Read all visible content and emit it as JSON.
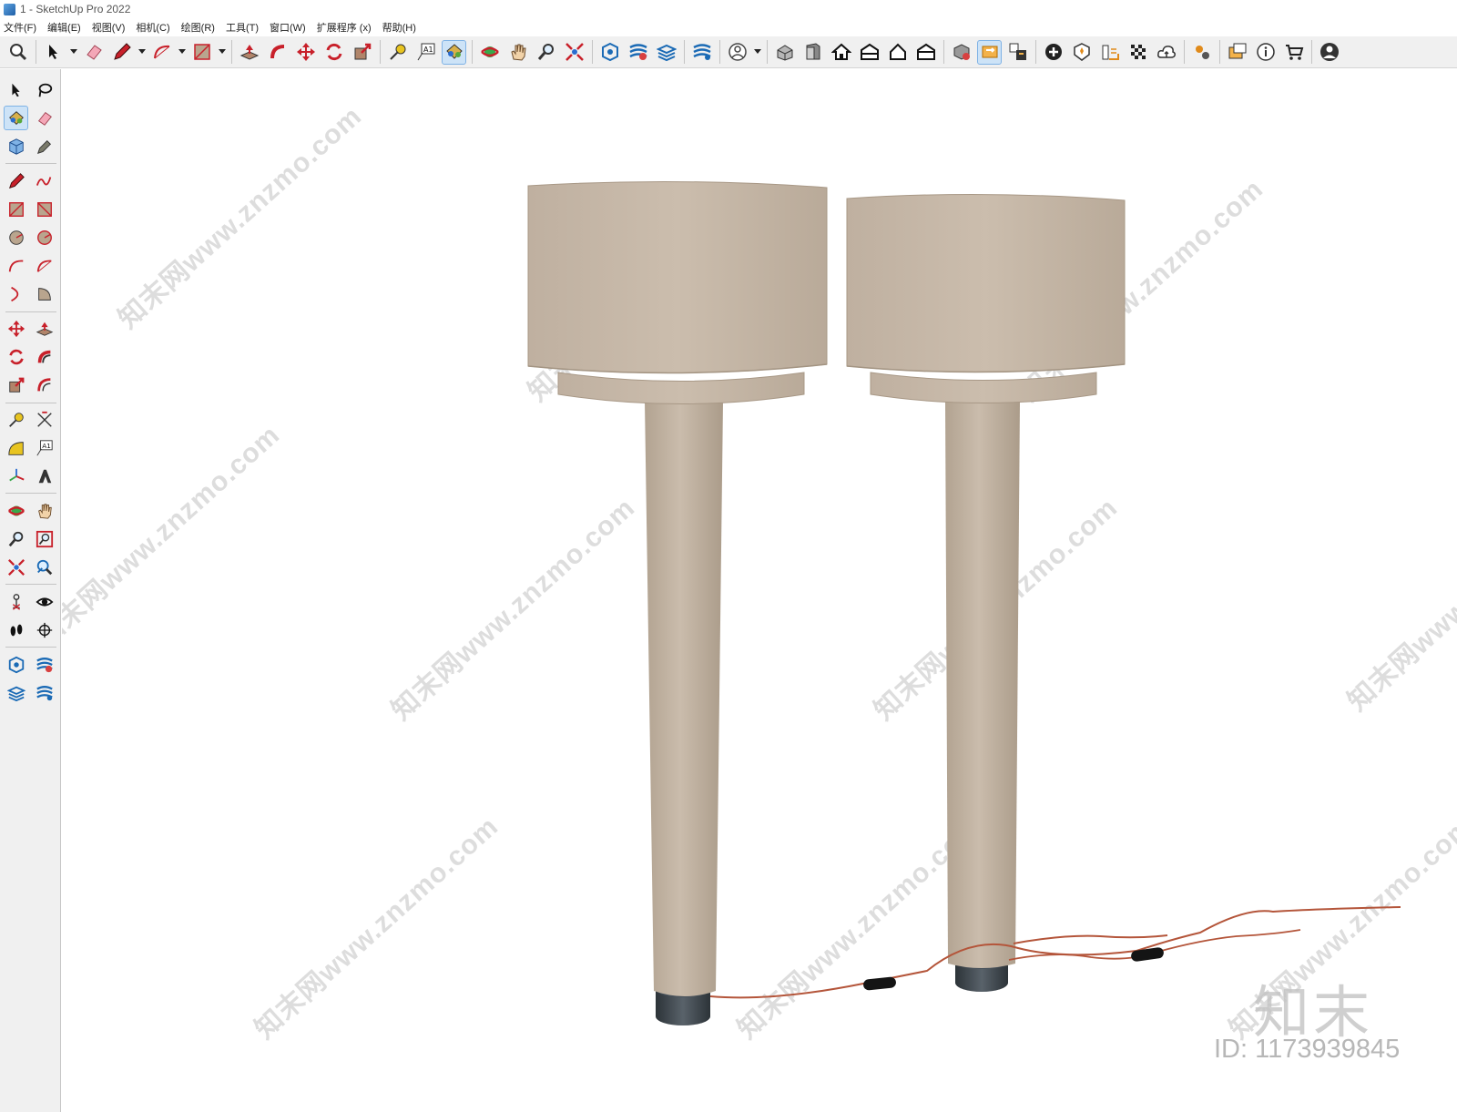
{
  "window": {
    "title": "1 - SketchUp Pro 2022",
    "app_icon": "sketchup-logo-icon"
  },
  "menu": {
    "items": [
      {
        "label": "文件(F)"
      },
      {
        "label": "编辑(E)"
      },
      {
        "label": "视图(V)"
      },
      {
        "label": "相机(C)"
      },
      {
        "label": "绘图(R)"
      },
      {
        "label": "工具(T)"
      },
      {
        "label": "窗口(W)"
      },
      {
        "label": "扩展程序 (x)"
      },
      {
        "label": "帮助(H)"
      }
    ]
  },
  "toolbar": {
    "icons": [
      "zoom-extents-icon",
      "select-icon",
      "eraser-icon",
      "pencil-icon",
      "arc-icon",
      "rectangle-icon",
      "push-pull-icon",
      "follow-me-icon",
      "move-icon",
      "rotate-icon",
      "scale-icon",
      "tape-measure-icon",
      "text-icon",
      "paint-bucket-icon",
      "orbit-icon",
      "pan-icon",
      "zoom-icon",
      "zoom-window-icon",
      "sandbox-icon",
      "layers-icon",
      "tags-icon",
      "outliner-icon",
      "styles-icon",
      "iso-view-icon",
      "front-view-icon",
      "home-view-icon",
      "right-view-icon",
      "back-view-icon",
      "left-view-icon",
      "solid-tools-icon",
      "section-plane-icon",
      "section-display-icon",
      "add-location-icon",
      "shadows-icon",
      "fog-icon",
      "match-photo-icon",
      "cloud-icon",
      "extension-manager-icon",
      "dialog-icon",
      "info-icon",
      "warehouse-icon",
      "account-icon"
    ]
  },
  "sidebar": {
    "icons": [
      "select-icon",
      "lasso-icon",
      "paint-bucket-icon",
      "eraser-icon",
      "component-icon",
      "tag-icon",
      "line-icon",
      "freehand-icon",
      "rectangle-icon",
      "rotated-rectangle-icon",
      "circle-icon",
      "polygon-icon",
      "arc-icon",
      "two-point-arc-icon",
      "three-point-arc-icon",
      "pie-icon",
      "move-icon",
      "push-pull-icon",
      "rotate-icon",
      "follow-me-icon",
      "scale-icon",
      "offset-icon",
      "tape-measure-icon",
      "dimension-icon",
      "protractor-icon",
      "text-icon",
      "axes-icon",
      "3d-text-icon",
      "orbit-icon",
      "pan-icon",
      "zoom-icon",
      "zoom-window-icon",
      "zoom-extents-icon",
      "previous-view-icon",
      "position-camera-icon",
      "look-around-icon",
      "walk-icon",
      "section-plane-icon",
      "sandbox-icon",
      "layers-icon",
      "tags-icon",
      "outliner-icon"
    ]
  },
  "viewport": {
    "scene": "two-floor-lamps-with-linen-shades",
    "watermark": "知末网www.znzmo.com",
    "brand_mark": "知末",
    "id_label": "ID: 1173939845",
    "colors": {
      "linen": "#c6b8a8",
      "linen_shadow": "#b3a494",
      "base": "#3c4348",
      "cord": "#b4553a",
      "plug": "#141414"
    }
  }
}
